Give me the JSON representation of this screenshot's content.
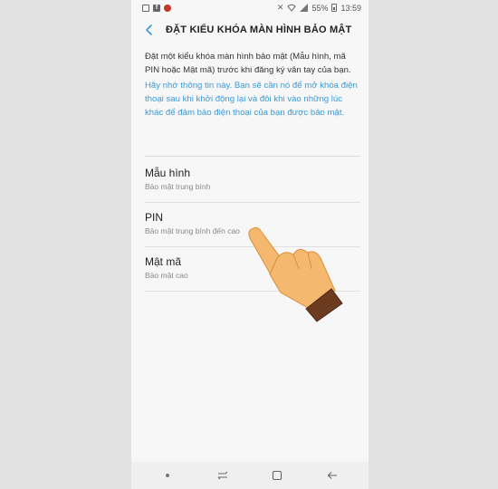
{
  "status_bar": {
    "battery": "55%",
    "time": "13:59"
  },
  "header": {
    "title": "ĐẶT KIỂU KHÓA MÀN HÌNH BẢO MẬT",
    "back_icon": "chevron-left-icon"
  },
  "content": {
    "intro": "Đặt một kiểu khóa màn hình bảo mật (Mẫu hình, mã PIN hoặc Mật mã) trước khi đăng ký vân tay của bạn.",
    "info": "Hãy nhớ thông tin này. Bạn sẽ cần nó để mở khóa điện thoại sau khi khởi động lại và đôi khi vào những lúc khác để đảm bảo điện thoại của bạn được bảo mật."
  },
  "options": [
    {
      "title": "Mẫu hình",
      "subtitle": "Bảo mật trung bình"
    },
    {
      "title": "PIN",
      "subtitle": "Bảo mật trung bình đến cao"
    },
    {
      "title": "Mật mã",
      "subtitle": "Bảo mật cao"
    }
  ],
  "colors": {
    "accent": "#3a9ad9",
    "background": "#f7f7f7",
    "hand_skin": "#f4b96e",
    "hand_cuff": "#6b3a1f"
  }
}
